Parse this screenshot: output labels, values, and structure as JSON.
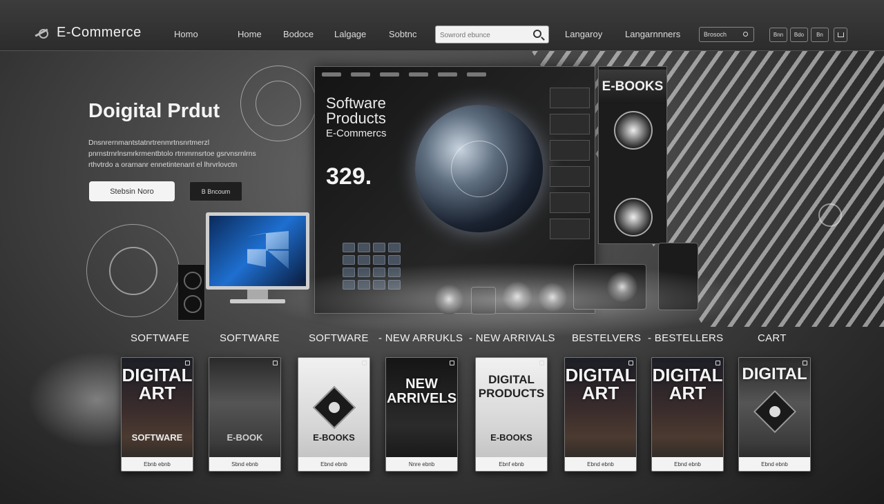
{
  "nav": {
    "logo_text": "E-Commerce",
    "links": [
      "Homo",
      "Home",
      "Bodoce",
      "Lalgage",
      "Sobtnc",
      "Langaroy",
      "Langarnnners"
    ],
    "search_placeholder": "Sowrord ebunce",
    "search2_label": "Brosoch",
    "buttons": [
      "Bnn",
      "Bdo",
      "Bn"
    ]
  },
  "hero": {
    "title": "Doigital Prdut",
    "description": "Dnsnrernmantstatnrtrenmrtnsnrtmerzl pnrnstrnrlnsmrkrmentbtolo rtrnmrnsrtoe gsrvnsrnlrns rthvtrdo a orarnanr ennetintenant el lhrvrlovctn",
    "cta_primary": "Stebsin Noro",
    "cta_secondary": "B Bncoum"
  },
  "dashboard": {
    "title_lines": [
      "Software",
      "Products",
      "E-Commercs"
    ],
    "big_number": "329."
  },
  "ebook_panel": {
    "title": "E-BOOKS"
  },
  "categories": [
    "SOFTWAFE",
    "SOFTWARE",
    "SOFTWARE",
    "- NEW ARRUKLS",
    "- NEW ARRIVALS",
    "BESTELVERS",
    "- BESTELLERS",
    "CART"
  ],
  "products": [
    {
      "title": "DIGITAL ART",
      "subtitle": "SOFTWARE",
      "label": "Ebnb ebnb"
    },
    {
      "title": "",
      "subtitle": "E-BOOK",
      "label": "Sbnd ebnb"
    },
    {
      "title": "",
      "subtitle": "E-BOOKS",
      "label": "Ebnd ebnb"
    },
    {
      "title": "NEW ARRIVELS",
      "subtitle": "",
      "label": "Nnre ebnb"
    },
    {
      "title": "DIGITAL PRODUCTS",
      "subtitle": "E-BOOKS",
      "label": "Ebnf ebnb"
    },
    {
      "title": "DIGITAL ART",
      "subtitle": "",
      "label": "Ebnd ebnb"
    },
    {
      "title": "DIGITAL ART",
      "subtitle": "",
      "label": "Ebnd ebnb"
    },
    {
      "title": "DIGITAL",
      "subtitle": "",
      "label": "Ebnd ebnb"
    }
  ]
}
